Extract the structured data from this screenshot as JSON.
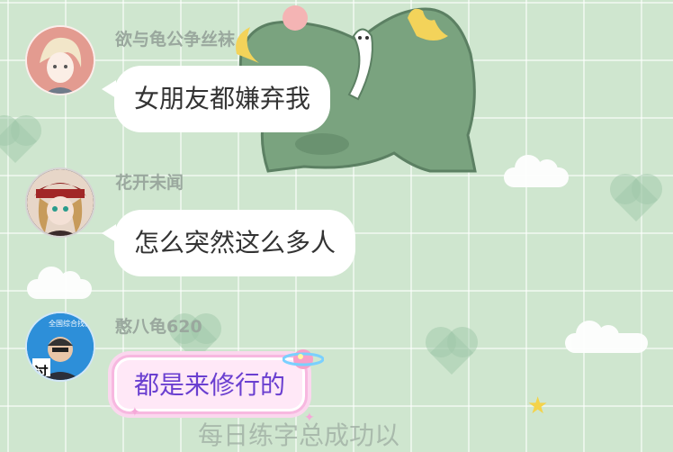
{
  "messages": [
    {
      "sender": "欲与龟公争丝袜",
      "text": "女朋友都嫌弃我"
    },
    {
      "sender": "花开未闻",
      "text": "怎么突然这么多人"
    },
    {
      "sender": "憨八龟620",
      "text": "都是来修行的",
      "avatar_caption": "过",
      "avatar_logo": "全国综合找商"
    }
  ],
  "bottom_text": "每日练字总成功以",
  "colors": {
    "background": "#cfe6cf",
    "bubble": "#ffffff",
    "fancy_bubble": "#ffe8f7",
    "fancy_text": "#6a3fd0",
    "sender": "#9aa89e"
  }
}
